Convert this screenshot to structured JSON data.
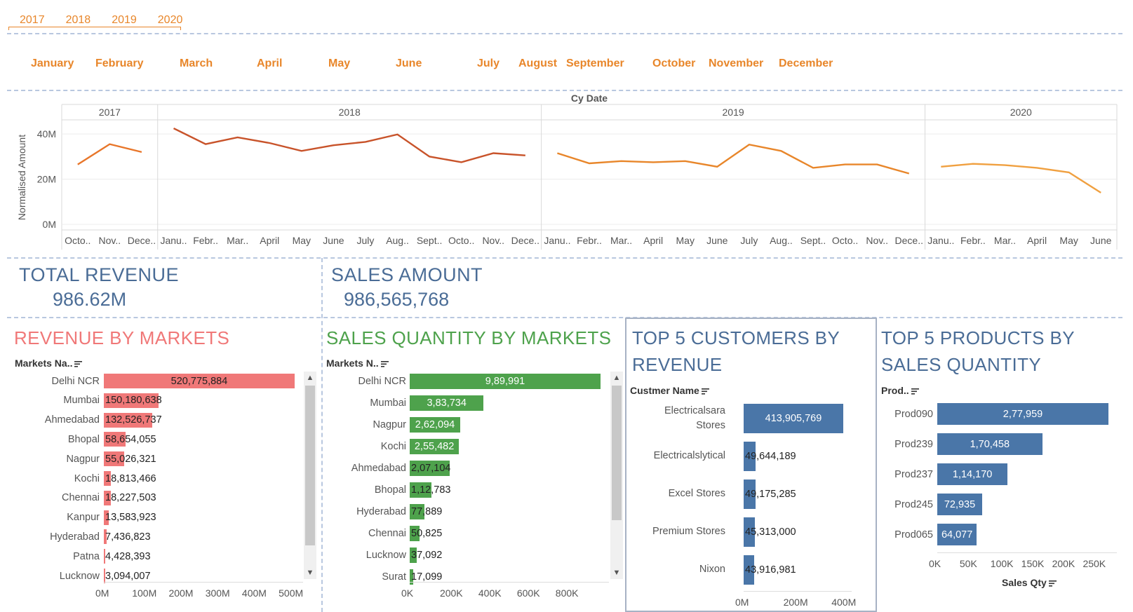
{
  "filters": {
    "years": [
      "2017",
      "2018",
      "2019",
      "2020"
    ],
    "months": [
      "January",
      "February",
      "March",
      "April",
      "May",
      "June",
      "July",
      "August",
      "September",
      "October",
      "November",
      "December"
    ]
  },
  "trend": {
    "header": "Cy Date",
    "ylabel": "Normalised Amount",
    "yticks": [
      "40M",
      "20M",
      "0M"
    ]
  },
  "chart_data": [
    {
      "type": "line",
      "title": "",
      "xlabel": "Cy Date",
      "ylabel": "Normalised Amount",
      "ylim": [
        0,
        45000000
      ],
      "series": [
        {
          "name": "",
          "panel": "2017",
          "x": [
            "Octo..",
            "Nov..",
            "Dece.."
          ],
          "values": [
            26500000,
            35500000,
            32000000
          ]
        },
        {
          "name": "",
          "panel": "2018",
          "x": [
            "Janu..",
            "Febr..",
            "Mar..",
            "April",
            "May",
            "June",
            "July",
            "Aug..",
            "Sept..",
            "Octo..",
            "Nov..",
            "Dece.."
          ],
          "values": [
            42500000,
            35500000,
            38500000,
            36000000,
            32500000,
            35000000,
            36500000,
            39800000,
            30000000,
            27500000,
            31500000,
            30500000
          ]
        },
        {
          "name": "",
          "panel": "2019",
          "x": [
            "Janu..",
            "Febr..",
            "Mar..",
            "April",
            "May",
            "June",
            "July",
            "Aug..",
            "Sept..",
            "Octo..",
            "Nov..",
            "Dece.."
          ],
          "values": [
            31500000,
            27000000,
            28000000,
            27500000,
            28000000,
            25500000,
            35300000,
            32500000,
            25000000,
            26500000,
            26500000,
            22500000
          ]
        },
        {
          "name": "",
          "panel": "2020",
          "x": [
            "Janu..",
            "Febr..",
            "Mar..",
            "April",
            "May",
            "June"
          ],
          "values": [
            25500000,
            26800000,
            26200000,
            25000000,
            23000000,
            14000000
          ]
        }
      ]
    },
    {
      "type": "bar",
      "title": "REVENUE BY MARKETS",
      "categories": [
        "Delhi NCR",
        "Mumbai",
        "Ahmedabad",
        "Bhopal",
        "Nagpur",
        "Kochi",
        "Chennai",
        "Kanpur",
        "Hyderabad",
        "Patna",
        "Lucknow"
      ],
      "values": [
        520775884,
        150180638,
        132526737,
        58654055,
        55026321,
        18813466,
        18227503,
        13583923,
        7436823,
        4428393,
        3094007
      ],
      "labels": [
        "520,775,884",
        "150,180,638",
        "132,526,737",
        "58,654,055",
        "55,026,321",
        "18,813,466",
        "18,227,503",
        "13,583,923",
        "7,436,823",
        "4,428,393",
        "3,094,007"
      ],
      "xticks": [
        "0M",
        "100M",
        "200M",
        "300M",
        "400M",
        "500M"
      ],
      "xlim": [
        0,
        520775884
      ],
      "ylabel": "Markets Na.."
    },
    {
      "type": "bar",
      "title": "SALES QUANTITY BY MARKETS",
      "categories": [
        "Delhi NCR",
        "Mumbai",
        "Nagpur",
        "Kochi",
        "Ahmedabad",
        "Bhopal",
        "Hyderabad",
        "Chennai",
        "Lucknow",
        "Surat"
      ],
      "values": [
        989991,
        383734,
        262094,
        255482,
        207104,
        112783,
        77889,
        50825,
        37092,
        17099
      ],
      "labels": [
        "9,89,991",
        "3,83,734",
        "2,62,094",
        "2,55,482",
        "2,07,104",
        "1,12,783",
        "77,889",
        "50,825",
        "37,092",
        "17,099"
      ],
      "xticks": [
        "0K",
        "200K",
        "400K",
        "600K",
        "800K"
      ],
      "xlim": [
        0,
        989991
      ],
      "ylabel": "Markets N.."
    },
    {
      "type": "bar",
      "title": "TOP 5 CUSTOMERS BY REVENUE",
      "categories": [
        "Electricalsara Stores",
        "Electricalslytical",
        "Excel Stores",
        "Premium Stores",
        "Nixon"
      ],
      "values": [
        413905769,
        49644189,
        49175285,
        45313000,
        43916981
      ],
      "labels": [
        "413,905,769",
        "49,644,189",
        "49,175,285",
        "45,313,000",
        "43,916,981"
      ],
      "xticks": [
        "0M",
        "200M",
        "400M"
      ],
      "xlim": [
        0,
        413905769
      ],
      "ylabel": "Custmer Name"
    },
    {
      "type": "bar",
      "title": "TOP 5 PRODUCTS BY SALES QUANTITY",
      "categories": [
        "Prod090",
        "Prod239",
        "Prod237",
        "Prod245",
        "Prod065"
      ],
      "values": [
        277959,
        170458,
        114170,
        72935,
        64077
      ],
      "labels": [
        "2,77,959",
        "1,70,458",
        "1,14,170",
        "72,935",
        "64,077"
      ],
      "xticks": [
        "0K",
        "50K",
        "100K",
        "150K",
        "200K",
        "250K"
      ],
      "xlim": [
        0,
        277959
      ],
      "ylabel": "Prod..",
      "xlabel": "Sales Qty"
    }
  ],
  "kpis": {
    "revenue_title": "TOTAL REVENUE",
    "revenue_value": "986.62M",
    "sales_title": "SALES AMOUNT",
    "sales_value": "986,565,768"
  },
  "colors": {
    "accent_orange": "#e8862a",
    "kpi_blue": "#4a6c96",
    "revenue_red": "#f07878",
    "qty_green": "#4ea24c",
    "steel_blue": "#4a76a8"
  }
}
